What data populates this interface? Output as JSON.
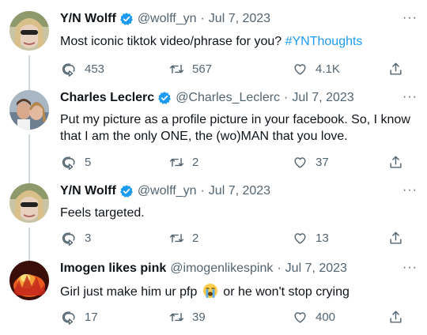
{
  "tweets": [
    {
      "name": "Y/N Wolff",
      "verified": true,
      "handle": "@wolff_yn",
      "separator": "·",
      "date": "Jul 7, 2023",
      "text": "Most iconic tiktok video/phrase for you?",
      "hashtag": "#YNThoughts",
      "replies": "453",
      "retweets": "567",
      "likes": "4.1K"
    },
    {
      "name": "Charles Leclerc",
      "verified": true,
      "handle": "@Charles_Leclerc",
      "separator": "·",
      "date": "Jul 7, 2023",
      "text": "Put my picture as a profile picture in your facebook. So, I know that I am the only ONE, the (wo)MAN that you love.",
      "replies": "5",
      "retweets": "2",
      "likes": "37"
    },
    {
      "name": "Y/N Wolff",
      "verified": true,
      "handle": "@wolff_yn",
      "separator": "·",
      "date": "Jul 7, 2023",
      "text": "Feels targeted.",
      "replies": "3",
      "retweets": "2",
      "likes": "13"
    },
    {
      "name": "Imogen likes pink",
      "verified": false,
      "handle": "@imogenlikespink",
      "separator": "·",
      "date": "Jul 7, 2023",
      "text_before": "Girl just make him ur pfp",
      "emoji": "loudly-crying-face",
      "text_after": "or he won't stop crying",
      "replies": "17",
      "retweets": "39",
      "likes": "400"
    }
  ],
  "more_label": "···",
  "colors": {
    "accent": "#1d9bf0",
    "muted": "#536471",
    "text": "#0f1419",
    "thread_line": "#cfd9de"
  }
}
